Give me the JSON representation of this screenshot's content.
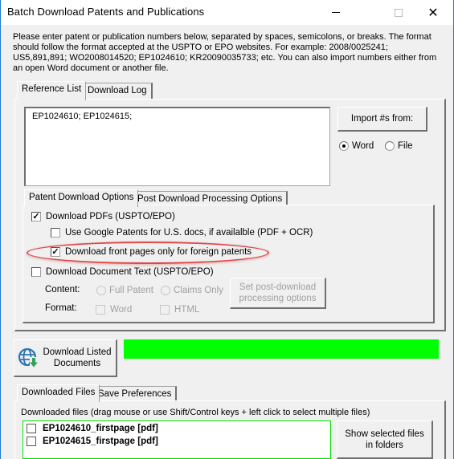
{
  "window": {
    "title": "Batch Download Patents and Publications",
    "controls": {
      "minimize": "—",
      "maximize": "☐",
      "close": "✕"
    }
  },
  "intro_text": "Please enter patent or publication numbers  below, separated by spaces, semicolons, or breaks. The format should follow the format accepted at the USPTO or EPO websites.  For example: 2008/0025241; US5,891,891; WO2008014520; EP1024610; KR20090035733; etc. You can also import numbers either from an open Word document or another file.",
  "top_tabs": [
    {
      "label": "Reference List",
      "active": true
    },
    {
      "label": "Download Log",
      "active": false
    }
  ],
  "reference_list": {
    "value": "EP1024610;  EP1024615;"
  },
  "import": {
    "button_label": "Import #s from:",
    "options": [
      {
        "label": "Word",
        "selected": true
      },
      {
        "label": "File",
        "selected": false
      }
    ]
  },
  "option_tabs": [
    {
      "label": "Patent Download Options",
      "active": true
    },
    {
      "label": "Post Download Processing Options",
      "active": false
    }
  ],
  "patent_options": {
    "download_pdfs": {
      "label": "Download PDFs (USPTO/EPO)",
      "checked": true
    },
    "use_google": {
      "label": "Use Google Patents for U.S. docs, if availalble (PDF + OCR)",
      "checked": false
    },
    "front_pages_only": {
      "label": "Download front pages only for foreign patents",
      "checked": true
    },
    "download_text": {
      "label": "Download Document Text (USPTO/EPO)",
      "checked": false
    },
    "content_label": "Content:",
    "content_options": [
      {
        "label": "Full Patent",
        "selected": false
      },
      {
        "label": "Claims Only",
        "selected": false
      }
    ],
    "format_label": "Format:",
    "format_options": [
      {
        "label": "Word",
        "checked": false
      },
      {
        "label": "HTML",
        "checked": false
      }
    ],
    "post_download_button": "Set post-download processing options"
  },
  "download_button": {
    "label_line1": "Download Listed",
    "label_line2": "Documents",
    "icon": "globe-download-icon"
  },
  "progress": {
    "percent": 100,
    "color": "#00ff00"
  },
  "bottom_tabs": [
    {
      "label": "Downloaded Files",
      "active": true
    },
    {
      "label": "Save Preferences",
      "active": false
    }
  ],
  "downloaded_files": {
    "hint": "Downloaded files (drag mouse or use Shift/Control keys + left click to select multiple files)",
    "items": [
      {
        "name": "EP1024610_firstpage [pdf]",
        "checked": false
      },
      {
        "name": "EP1024615_firstpage [pdf]",
        "checked": false
      }
    ],
    "show_button": "Show selected files in folders"
  }
}
